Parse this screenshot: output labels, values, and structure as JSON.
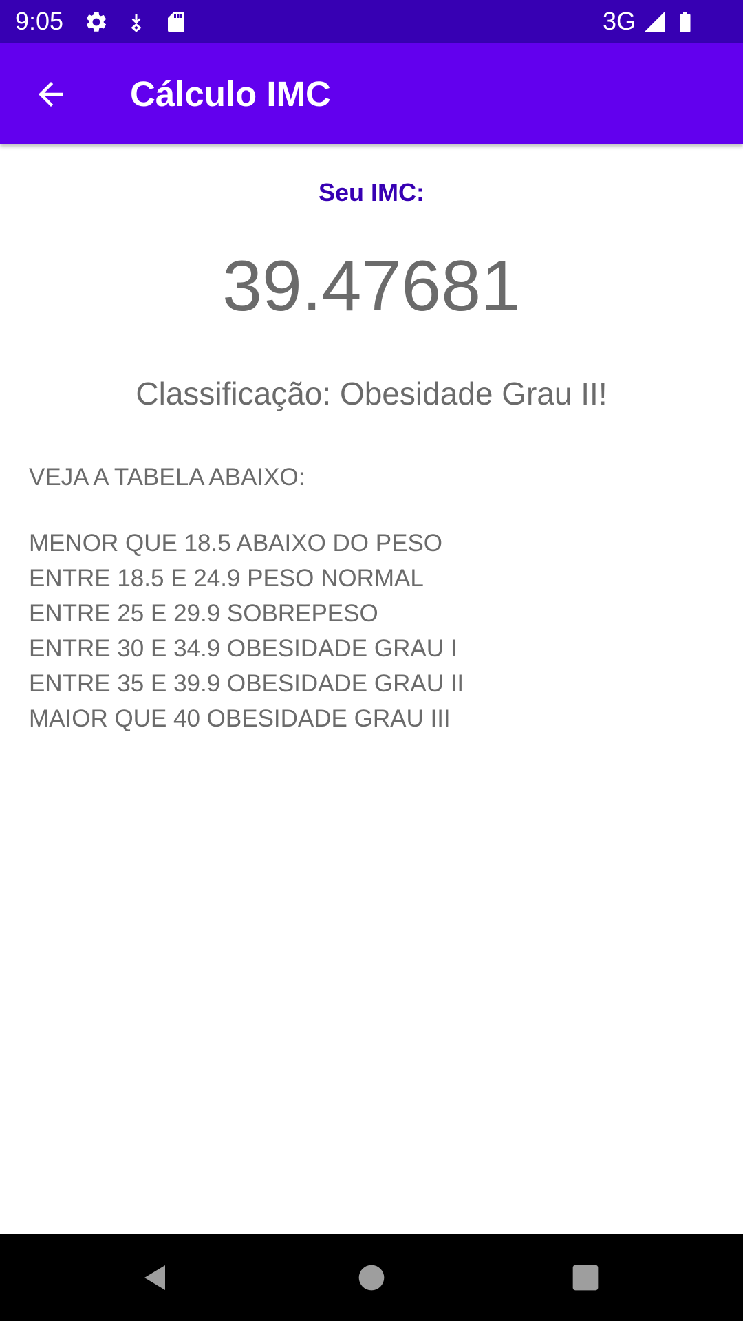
{
  "status_bar": {
    "time": "9:05",
    "network": "3G",
    "icons": [
      "settings-icon",
      "download-icon",
      "sd-card-icon",
      "signal-icon",
      "battery-icon"
    ]
  },
  "app_bar": {
    "title": "Cálculo IMC",
    "back_icon": "arrow-back-icon"
  },
  "result": {
    "label": "Seu IMC:",
    "value": "39.47681",
    "classification": "Classificação: Obesidade Grau II!"
  },
  "table": {
    "heading": "VEJA A TABELA ABAIXO:",
    "rows": [
      "MENOR QUE 18.5 ABAIXO DO PESO",
      "ENTRE 18.5 E 24.9 PESO NORMAL",
      "ENTRE 25 E 29.9 SOBREPESO",
      "ENTRE 30 E 34.9 OBESIDADE GRAU I",
      "ENTRE 35 E 39.9 OBESIDADE GRAU II",
      "MAIOR QUE 40 OBESIDADE GRAU III"
    ]
  },
  "nav_bar": {
    "buttons": [
      "back-triangle-icon",
      "home-circle-icon",
      "recents-square-icon"
    ]
  },
  "colors": {
    "status_bar": "#3700b3",
    "app_bar": "#6200ee",
    "label_accent": "#3700b3",
    "body_text": "#6b6b6b"
  }
}
